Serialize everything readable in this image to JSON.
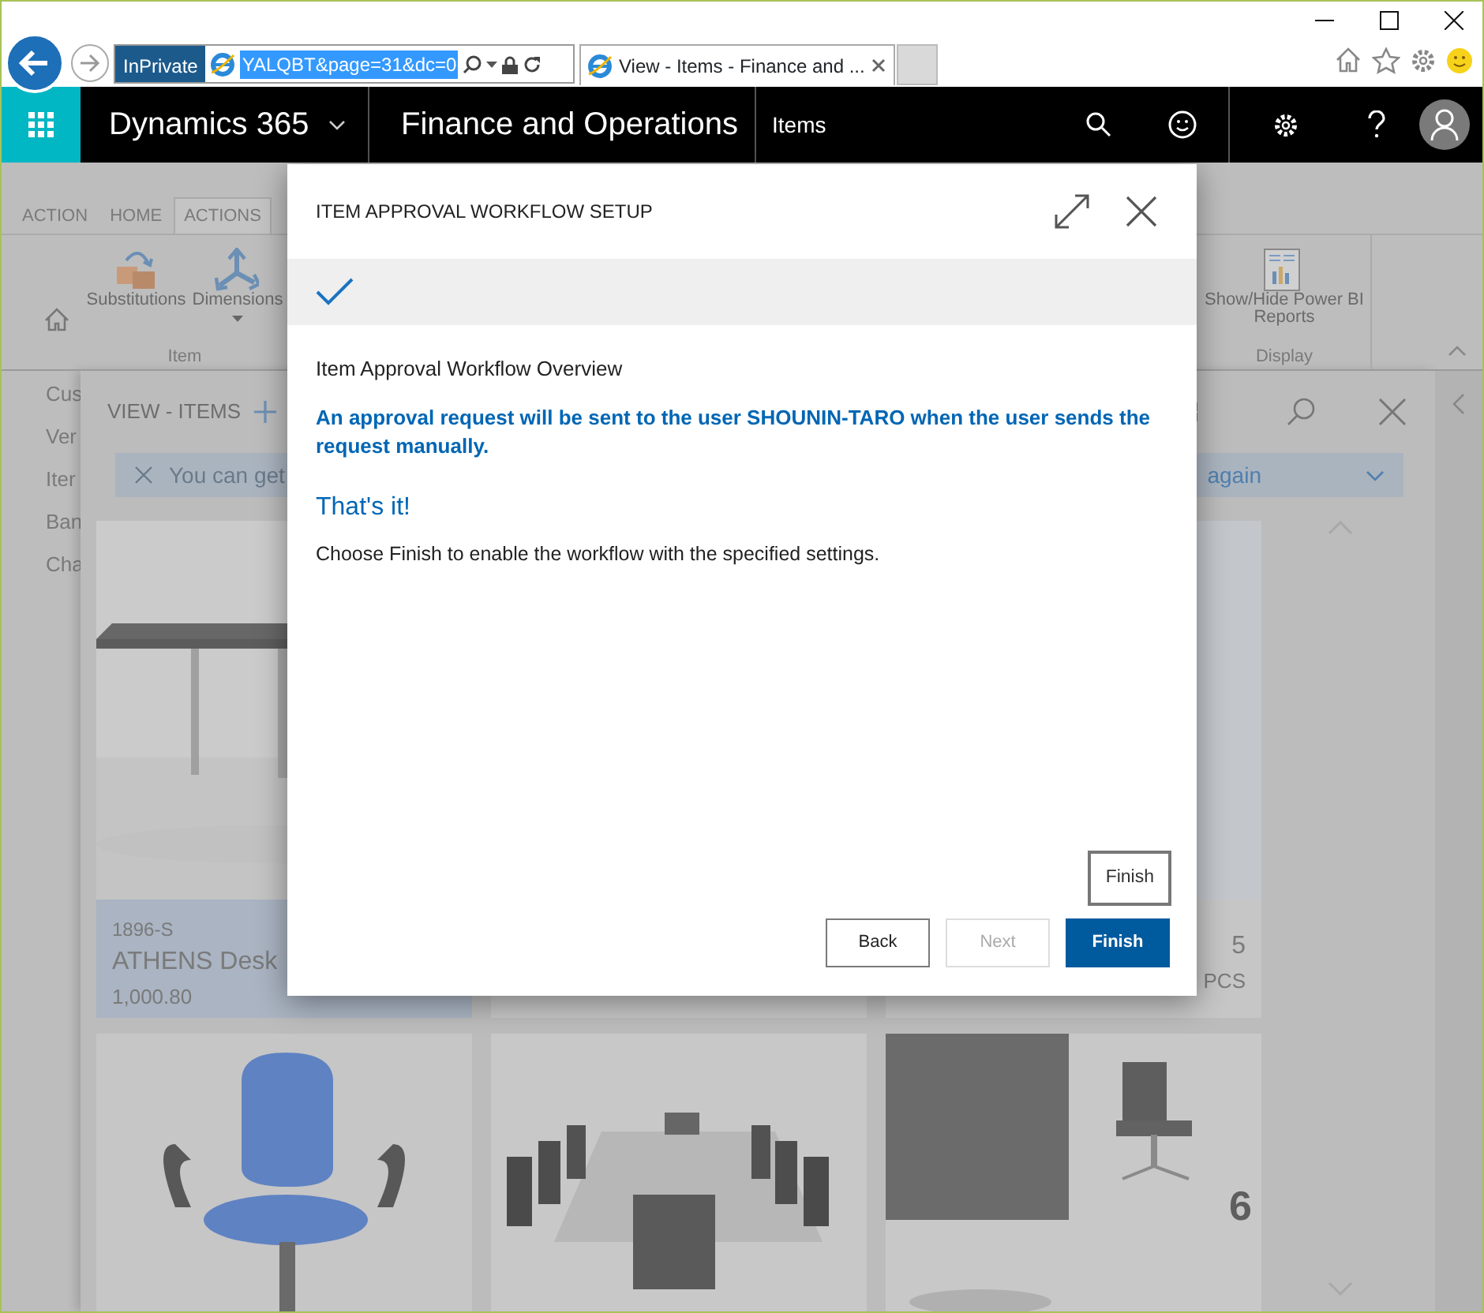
{
  "browser": {
    "inprivate": "InPrivate",
    "address": "YALQBT&page=31&dc=0",
    "tabs": [
      {
        "title": "View - Items - Finance and ...",
        "selected": true
      }
    ]
  },
  "app_bar": {
    "product": "Dynamics 365",
    "module": "Finance and Operations",
    "page": "Items"
  },
  "ribbon": {
    "tabs": [
      {
        "label": "ACTION",
        "selected": false
      },
      {
        "label": "HOME",
        "selected": false
      },
      {
        "label": "ACTIONS",
        "selected": true
      }
    ],
    "groups": [
      {
        "label": "Item",
        "buttons": [
          {
            "label": "Substitutions",
            "kind": "boxes",
            "dropdown": false
          },
          {
            "label": "Dimensions",
            "kind": "axes",
            "dropdown": true
          }
        ]
      },
      {
        "label": "Display",
        "buttons": [
          {
            "label": "Show/Hide Power BI Reports",
            "kind": "report",
            "dropdown": false
          }
        ]
      }
    ]
  },
  "nav": [
    "Cus",
    "Ver",
    "Iter",
    "Ban",
    "Cha"
  ],
  "view": {
    "title": "VIEW - ITEMS",
    "notice_start": "You can get",
    "notice_end": "again"
  },
  "tiles": [
    {
      "kind": "product",
      "selected": true,
      "number": "1896-S",
      "name": "ATHENS Desk",
      "price": "1,000.80"
    },
    {
      "kind": "product",
      "selected": false
    },
    {
      "kind": "product",
      "selected": false,
      "quantity": "5",
      "unit": "PCS"
    },
    {
      "kind": "picture"
    },
    {
      "kind": "picture"
    },
    {
      "kind": "picture",
      "badge": "6"
    }
  ],
  "dialog": {
    "title": "ITEM APPROVAL WORKFLOW SETUP",
    "step_done": true,
    "heading": "Item Approval Workflow Overview",
    "message": "An approval request will be sent to the user SHOUNIN-TARO when the user sends the request manually.",
    "subtitle": "That's it!",
    "body": "Choose Finish to enable the workflow with the specified settings.",
    "tooltip": "Finish",
    "buttons": [
      {
        "label": "Back",
        "kind": "default",
        "disabled": false
      },
      {
        "label": "Next",
        "kind": "default",
        "disabled": true
      },
      {
        "label": "Finish",
        "kind": "primary",
        "disabled": false
      }
    ]
  }
}
